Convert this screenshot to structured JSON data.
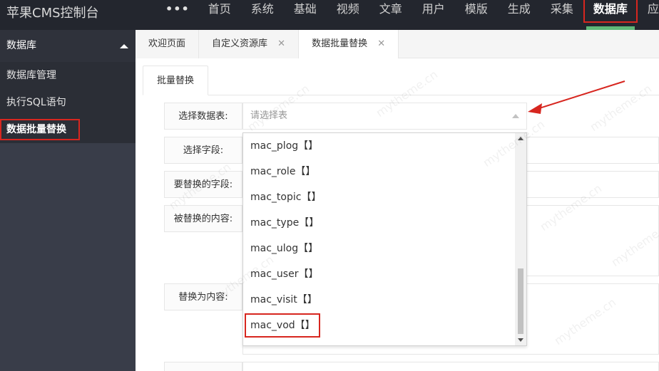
{
  "app": {
    "title": "苹果CMS控制台"
  },
  "topnav": {
    "more": "•••",
    "items": [
      {
        "label": "首页"
      },
      {
        "label": "系统"
      },
      {
        "label": "基础"
      },
      {
        "label": "视频"
      },
      {
        "label": "文章"
      },
      {
        "label": "用户"
      },
      {
        "label": "模版"
      },
      {
        "label": "生成"
      },
      {
        "label": "采集"
      },
      {
        "label": "数据库",
        "active": true
      },
      {
        "label": "应"
      }
    ]
  },
  "sidebar": {
    "header": "数据库",
    "items": [
      {
        "label": "数据库管理"
      },
      {
        "label": "执行SQL语句"
      },
      {
        "label": "数据批量替换",
        "current": true
      }
    ]
  },
  "tabs": [
    {
      "label": "欢迎页面",
      "closable": false
    },
    {
      "label": "自定义资源库",
      "closable": true
    },
    {
      "label": "数据批量替换",
      "closable": true,
      "active": true
    }
  ],
  "tab_close_glyph": "✕",
  "form": {
    "subtab": "批量替换",
    "table_label": "选择数据表:",
    "table_placeholder": "请选择表",
    "field_label": "选择字段:",
    "replace_field_label": "要替换的字段:",
    "replaced_content_label": "被替换的内容:",
    "replace_with_label": "替换为内容:"
  },
  "dropdown": {
    "options": [
      "mac_plog【】",
      "mac_role【】",
      "mac_topic【】",
      "mac_type【】",
      "mac_ulog【】",
      "mac_user【】",
      "mac_visit【】",
      "mac_vod【】"
    ],
    "highlighted": "mac_vod【】"
  },
  "watermark": "mytheme.cn",
  "colors": {
    "highlight_red": "#d7261f",
    "active_green": "#5fb878",
    "topbar_bg": "#23262e",
    "sidebar_bg": "#393d49"
  }
}
